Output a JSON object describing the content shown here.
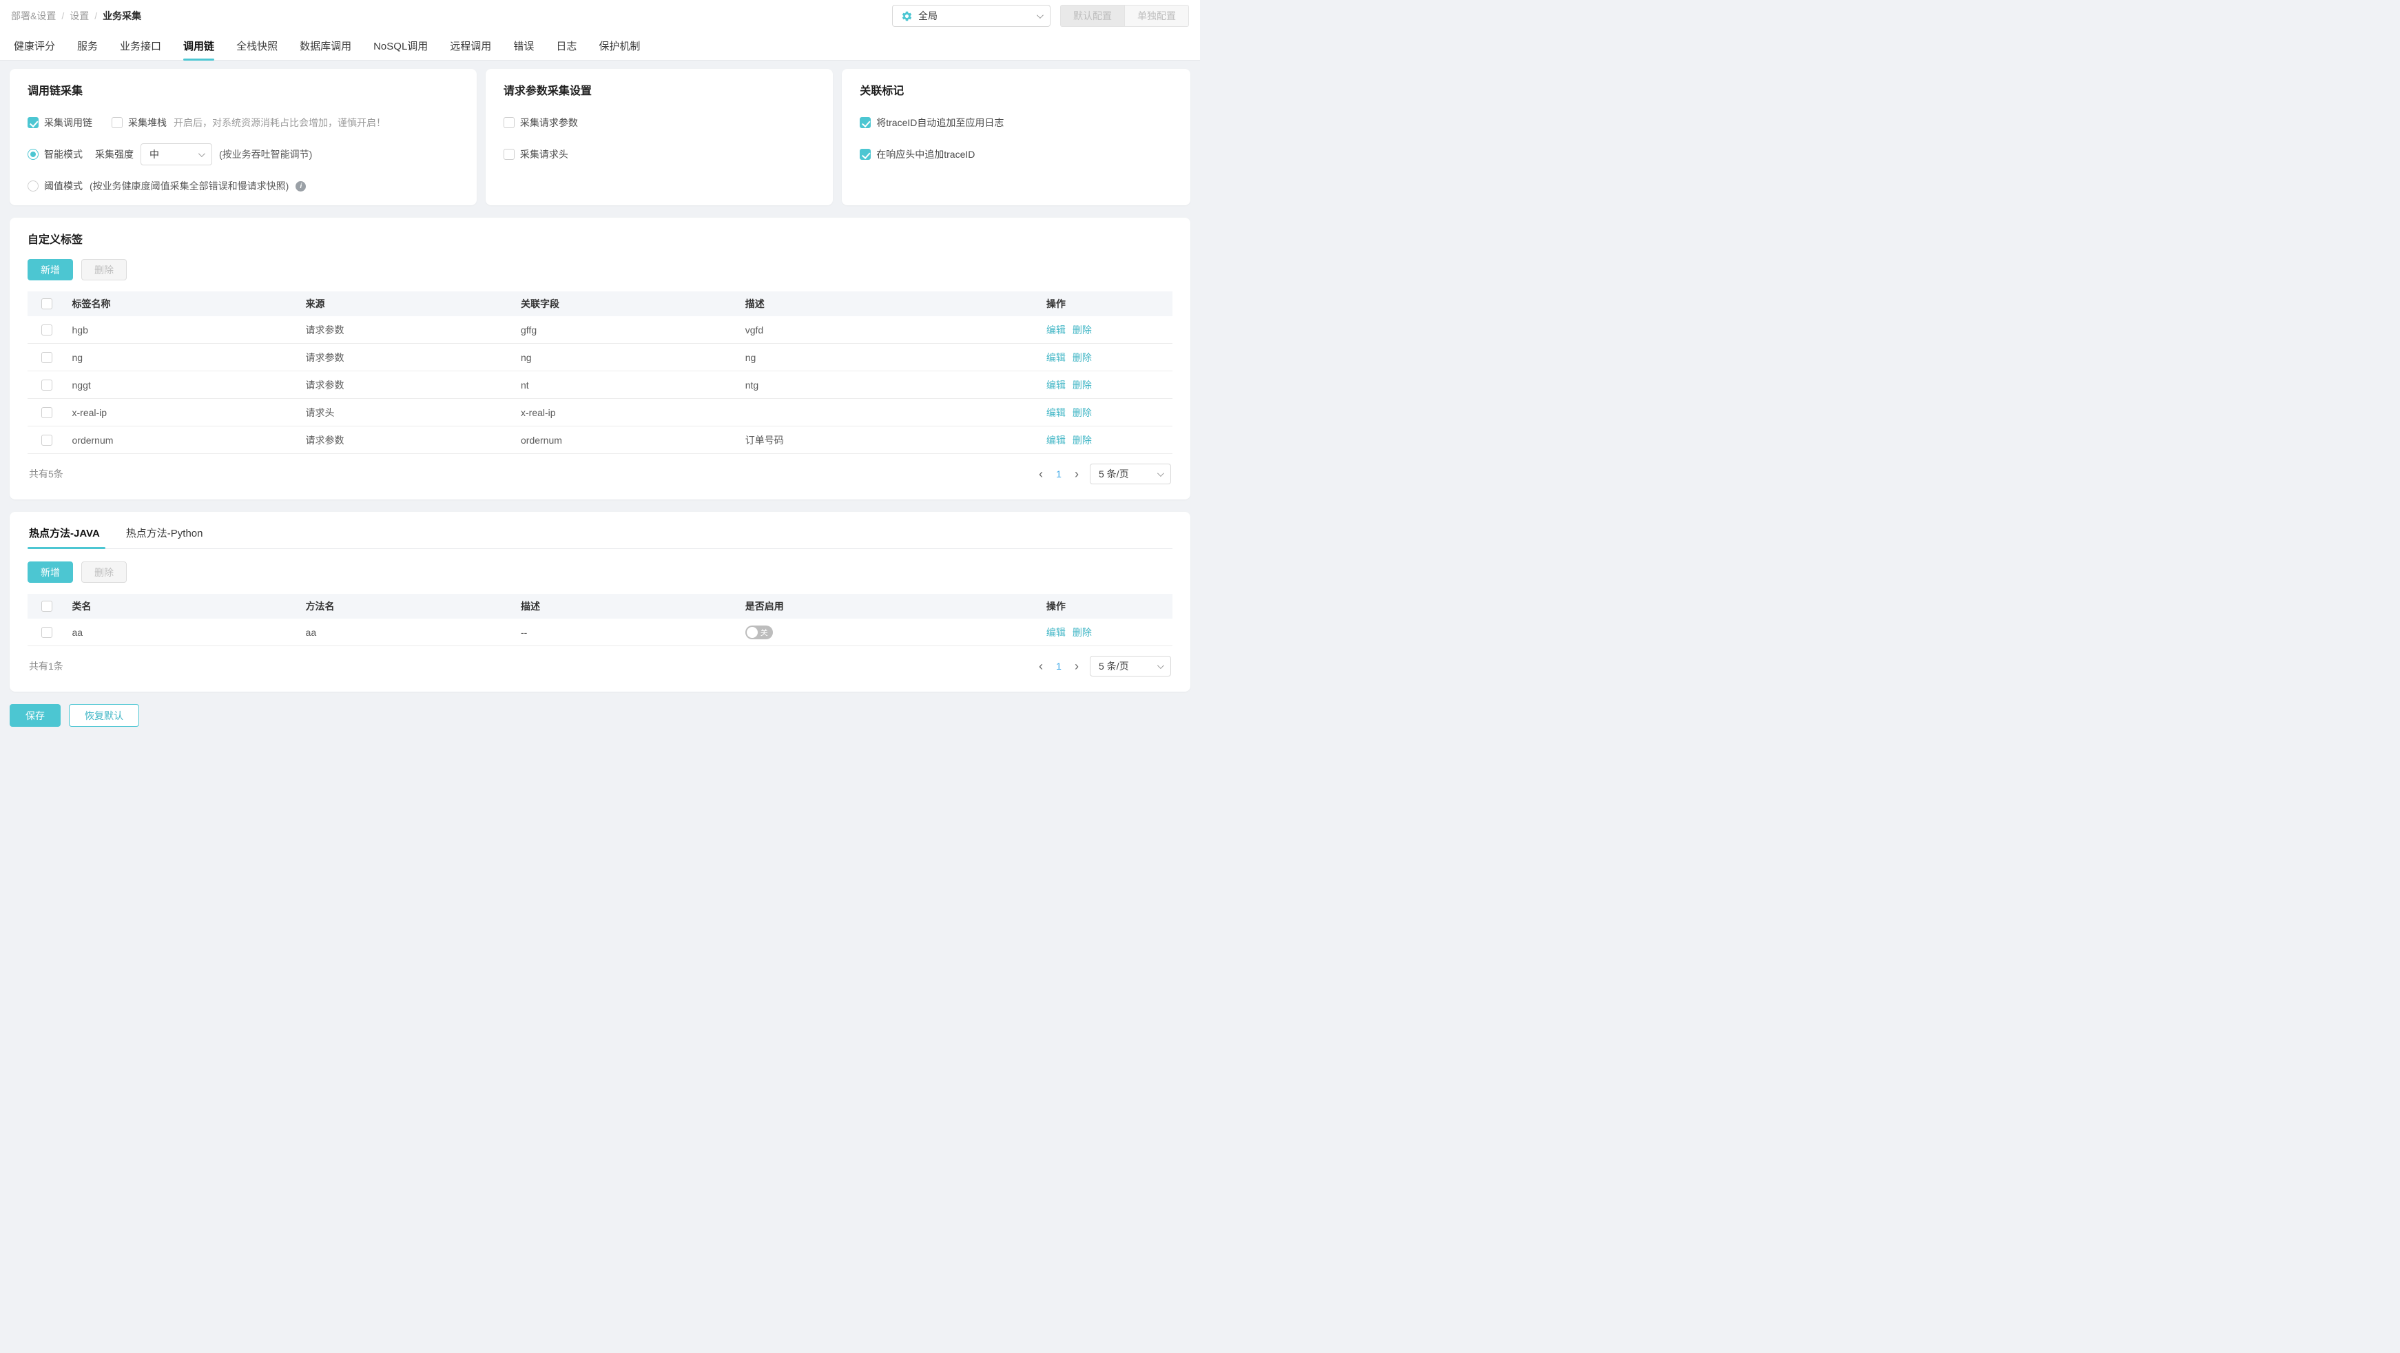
{
  "breadcrumb": {
    "separator": "/",
    "items": [
      "部署&设置",
      "设置",
      "业务采集"
    ]
  },
  "header": {
    "scope_select": {
      "value": "全局"
    },
    "config_buttons": [
      {
        "label": "默认配置"
      },
      {
        "label": "单独配置"
      }
    ]
  },
  "tabs": {
    "items": [
      {
        "label": "健康评分",
        "active": false
      },
      {
        "label": "服务",
        "active": false
      },
      {
        "label": "业务接口",
        "active": false
      },
      {
        "label": "调用链",
        "active": true
      },
      {
        "label": "全栈快照",
        "active": false
      },
      {
        "label": "数据库调用",
        "active": false
      },
      {
        "label": "NoSQL调用",
        "active": false
      },
      {
        "label": "远程调用",
        "active": false
      },
      {
        "label": "错误",
        "active": false
      },
      {
        "label": "日志",
        "active": false
      },
      {
        "label": "保护机制",
        "active": false
      }
    ]
  },
  "trace_collection": {
    "title": "调用链采集",
    "collect_trace": {
      "label": "采集调用链",
      "checked": true
    },
    "collect_stack": {
      "label": "采集堆栈",
      "checked": false
    },
    "stack_hint": "开启后，对系统资源消耗占比会增加，谨慎开启！",
    "smart_mode": {
      "label": "智能模式",
      "selected": true
    },
    "strength_label": "采集强度",
    "strength_value": "中",
    "smart_hint": "(按业务吞吐智能调节)",
    "threshold_mode": {
      "label": "阈值模式",
      "selected": false
    },
    "threshold_hint": "(按业务健康度阈值采集全部错误和慢请求快照)"
  },
  "request_params": {
    "title": "请求参数采集设置",
    "options": [
      {
        "label": "采集请求参数",
        "checked": false
      },
      {
        "label": "采集请求头",
        "checked": false
      }
    ]
  },
  "correlation": {
    "title": "关联标记",
    "options": [
      {
        "label": "将traceID自动追加至应用日志",
        "checked": true
      },
      {
        "label": "在响应头中追加traceID",
        "checked": true
      }
    ]
  },
  "custom_tags": {
    "title": "自定义标签",
    "add_label": "新增",
    "delete_label": "删除",
    "columns": [
      "标签名称",
      "来源",
      "关联字段",
      "描述",
      "操作"
    ],
    "rows": [
      {
        "name": "hgb",
        "source": "请求参数",
        "field": "gffg",
        "desc": "vgfd"
      },
      {
        "name": "ng",
        "source": "请求参数",
        "field": "ng",
        "desc": "ng"
      },
      {
        "name": "nggt",
        "source": "请求参数",
        "field": "nt",
        "desc": "ntg"
      },
      {
        "name": "x-real-ip",
        "source": "请求头",
        "field": "x-real-ip",
        "desc": ""
      },
      {
        "name": "ordernum",
        "source": "请求参数",
        "field": "ordernum",
        "desc": "订单号码"
      }
    ],
    "actions": {
      "edit": "编辑",
      "delete": "删除"
    },
    "footer": {
      "total": "共有5条",
      "page": "1",
      "page_size": "5 条/页"
    }
  },
  "hot_methods": {
    "tabs": [
      {
        "label": "热点方法-JAVA",
        "active": true
      },
      {
        "label": "热点方法-Python",
        "active": false
      }
    ],
    "add_label": "新增",
    "delete_label": "删除",
    "columns": [
      "类名",
      "方法名",
      "描述",
      "是否启用",
      "操作"
    ],
    "rows": [
      {
        "class_name": "aa",
        "method_name": "aa",
        "desc": "--",
        "enabled": false,
        "toggle_label": "关"
      }
    ],
    "actions": {
      "edit": "编辑",
      "delete": "删除"
    },
    "footer": {
      "total": "共有1条",
      "page": "1",
      "page_size": "5 条/页"
    }
  },
  "footer_actions": {
    "save": "保存",
    "reset": "恢复默认"
  },
  "icons": {
    "prev": "‹",
    "next": "›",
    "info": "i",
    "gear": "gear",
    "chevron": "chevron-down"
  },
  "colors": {
    "accent": "#4cc6d2",
    "link": "#3fb5c5",
    "page_active": "#3da8e8",
    "toggle_off": "#bdbdbd",
    "background": "#f0f2f5",
    "tab_underline": "#4cc6d2"
  }
}
